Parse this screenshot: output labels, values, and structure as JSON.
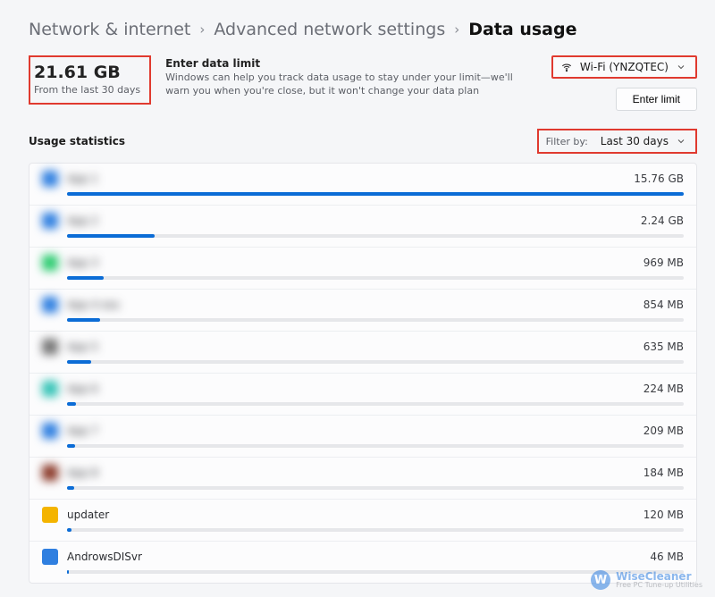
{
  "breadcrumb": {
    "root": "Network & internet",
    "mid": "Advanced network settings",
    "current": "Data usage"
  },
  "total": {
    "value": "21.61 GB",
    "subtext": "From the last 30 days"
  },
  "limit": {
    "title": "Enter data limit",
    "desc": "Windows can help you track data usage to stay under your limit—we'll warn you when you're close, but it won't change your data plan"
  },
  "network": {
    "label": "Wi-Fi (YNZQTEC)"
  },
  "enter_limit_button": "Enter limit",
  "stats_label": "Usage statistics",
  "filter": {
    "by_label": "Filter by:",
    "value": "Last 30 days"
  },
  "apps": [
    {
      "name": "App 1",
      "usage": "15.76 GB",
      "blur": true,
      "fillPct": 100,
      "iconColor": "#2f7fe0"
    },
    {
      "name": "App 2",
      "usage": "2.24 GB",
      "blur": true,
      "fillPct": 14.2,
      "iconColor": "#2f7fe0"
    },
    {
      "name": "App 3",
      "usage": "969 MB",
      "blur": true,
      "fillPct": 6.0,
      "iconColor": "#2ecc71"
    },
    {
      "name": "App 4 ess",
      "usage": "854 MB",
      "blur": true,
      "fillPct": 5.3,
      "iconColor": "#2f7fe0"
    },
    {
      "name": "App 5",
      "usage": "635 MB",
      "blur": true,
      "fillPct": 3.9,
      "iconColor": "#777777"
    },
    {
      "name": "App 6",
      "usage": "224 MB",
      "blur": true,
      "fillPct": 1.4,
      "iconColor": "#37c4b7"
    },
    {
      "name": "App 7",
      "usage": "209 MB",
      "blur": true,
      "fillPct": 1.3,
      "iconColor": "#2f7fe0"
    },
    {
      "name": "App 8",
      "usage": "184 MB",
      "blur": true,
      "fillPct": 1.1,
      "iconColor": "#8b3a2a"
    },
    {
      "name": "updater",
      "usage": "120 MB",
      "blur": false,
      "fillPct": 0.7,
      "iconColor": "#f4b400"
    },
    {
      "name": "AndrowsDISvr",
      "usage": "46 MB",
      "blur": false,
      "fillPct": 0.3,
      "iconColor": "#2f7fe0"
    }
  ],
  "watermark": {
    "letter": "W",
    "brand": "WiseCleaner",
    "tag": "Free PC Tune-up Utilities"
  }
}
